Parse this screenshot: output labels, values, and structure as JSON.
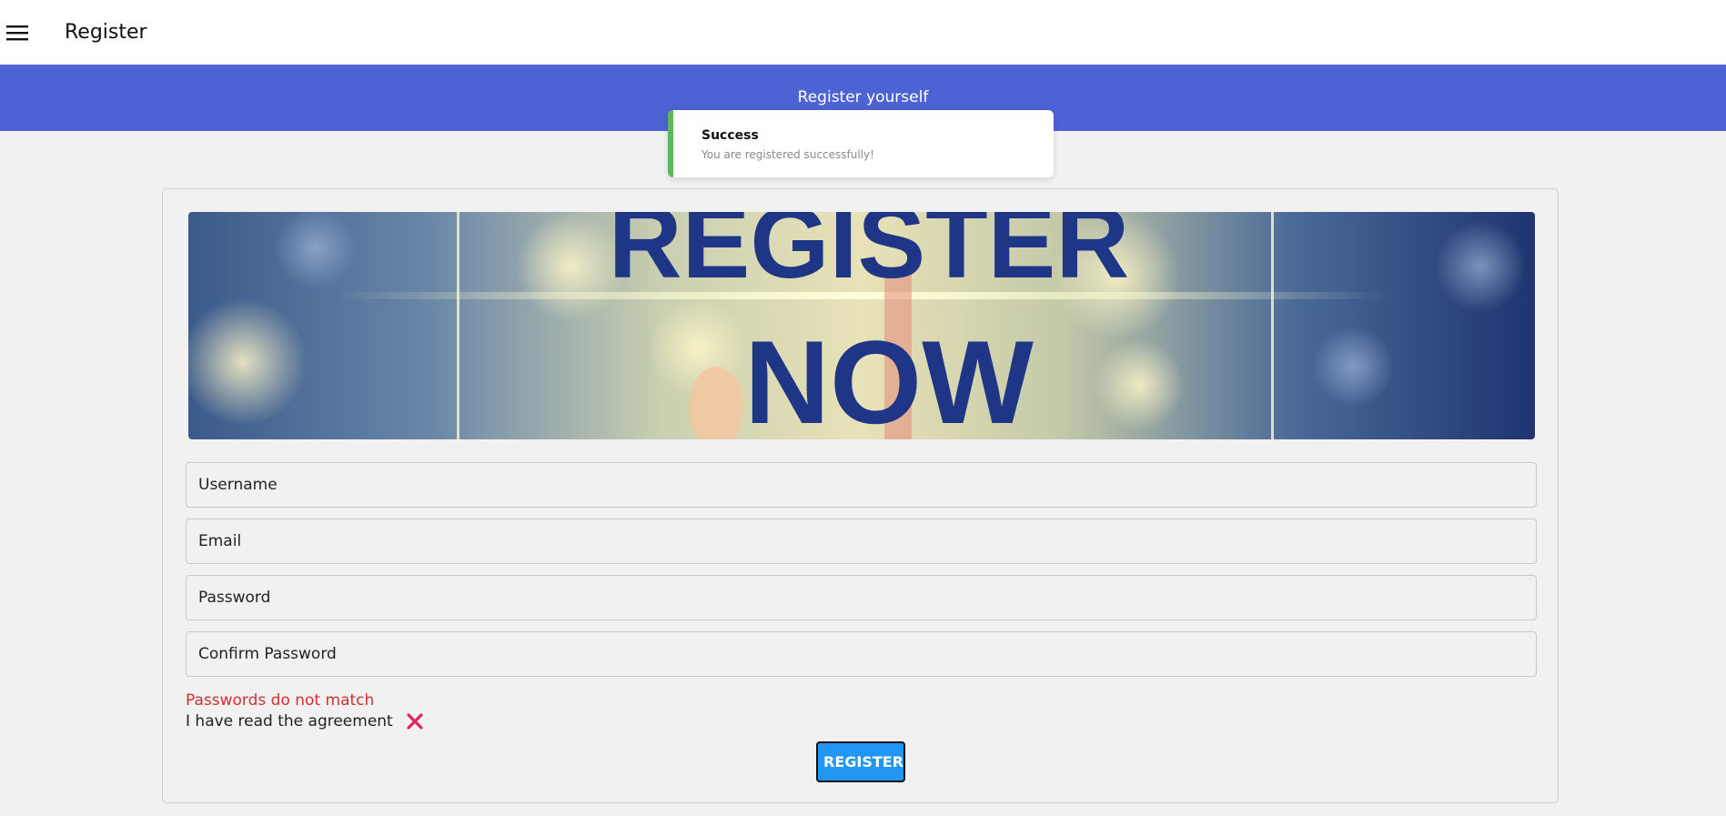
{
  "topbar": {
    "menu_icon": "hamburger-menu-icon",
    "title": "Register"
  },
  "header": {
    "subtitle": "Register yourself",
    "color": "#4d63d3"
  },
  "toast": {
    "title": "Success",
    "message": "You are registered successfully!",
    "accent_color": "#5cb85c"
  },
  "hero": {
    "line1": "REGISTER",
    "line2": "NOW"
  },
  "form": {
    "username_placeholder": "Username",
    "email_placeholder": "Email",
    "password_placeholder": "Password",
    "confirm_password_placeholder": "Confirm Password",
    "error": "Passwords do not match",
    "agreement_label": "I have read the agreement",
    "agreement_icon": "close-x-icon",
    "submit_label": "REGISTER",
    "submit_color": "#2196f3",
    "error_color": "#d32f2f"
  }
}
